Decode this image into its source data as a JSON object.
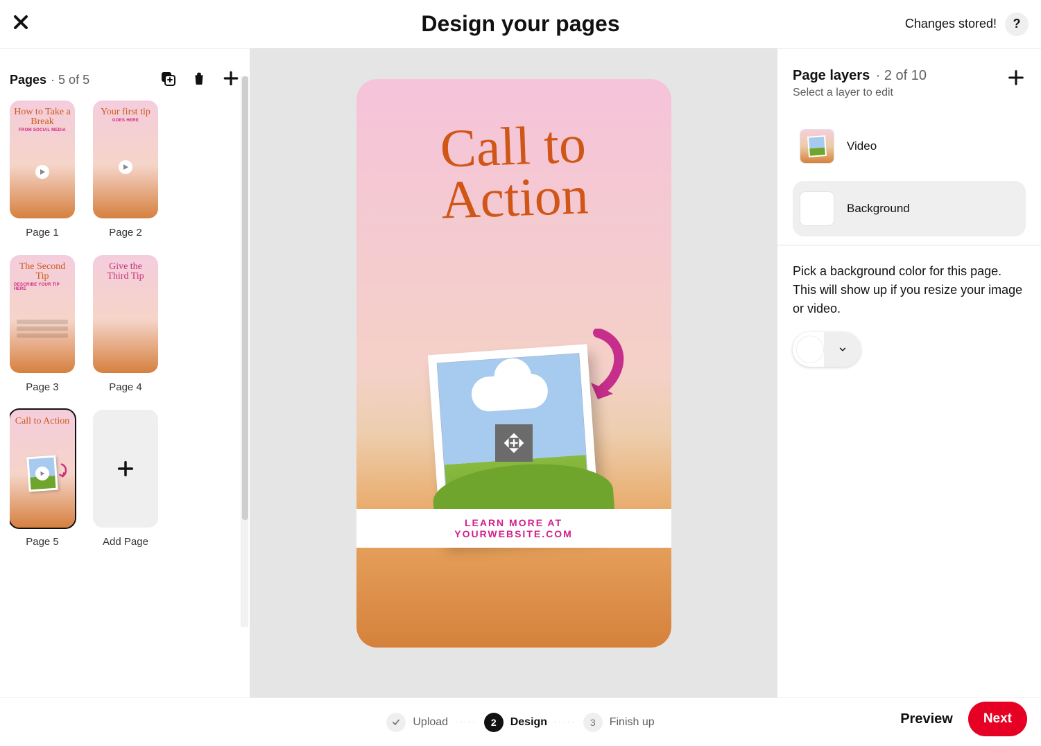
{
  "header": {
    "title": "Design your pages",
    "status": "Changes stored!",
    "help": "?"
  },
  "left": {
    "label": "Pages",
    "count": "· 5 of 5",
    "add_label": "Add Page",
    "pages": [
      {
        "label": "Page 1",
        "title": "How to Take a Break",
        "sub": "FROM SOCIAL MEDIA"
      },
      {
        "label": "Page 2",
        "title": "Your first tip",
        "sub": "GOES HERE"
      },
      {
        "label": "Page 3",
        "title": "The Second Tip",
        "sub": "DESCRIBE YOUR TIP HERE"
      },
      {
        "label": "Page 4",
        "title": "Give the Third Tip",
        "sub": ""
      },
      {
        "label": "Page 5",
        "title": "Call to Action",
        "sub": ""
      }
    ]
  },
  "center": {
    "script_line1": "Call to",
    "script_line2": "Action",
    "band_line1": "LEARN MORE AT",
    "band_line2": "YOURWEBSITE.COM"
  },
  "right": {
    "title": "Page layers",
    "count": "· 2 of 10",
    "sub": "Select a layer to edit",
    "layers": [
      {
        "name": "Video"
      },
      {
        "name": "Background"
      }
    ],
    "bg_help": "Pick a background color for this page. This will show up if you resize your image or video.",
    "bg_color": "#ffffff"
  },
  "footer": {
    "steps": [
      {
        "n": "✓",
        "label": "Upload",
        "state": "done"
      },
      {
        "n": "2",
        "label": "Design",
        "state": "active"
      },
      {
        "n": "3",
        "label": "Finish up",
        "state": "todo"
      }
    ],
    "preview": "Preview",
    "next": "Next"
  }
}
